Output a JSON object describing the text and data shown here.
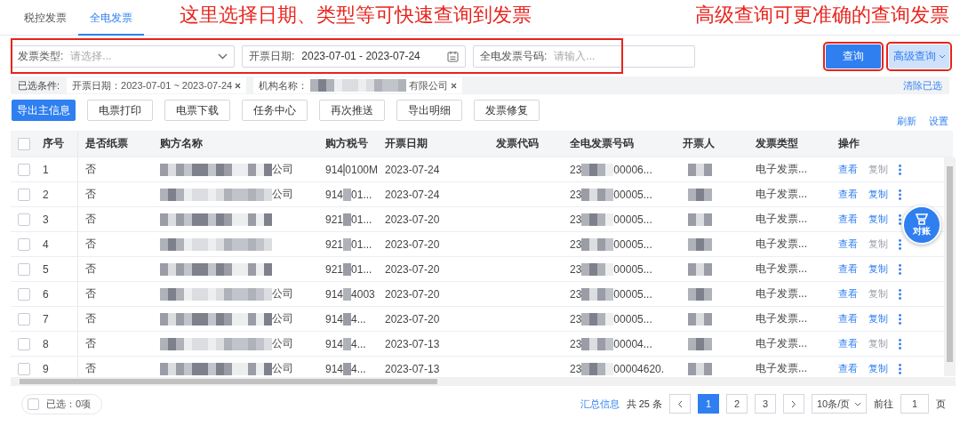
{
  "tabs": [
    {
      "label": "税控发票",
      "selected": false
    },
    {
      "label": "全电发票",
      "selected": true
    }
  ],
  "annotations": [
    "这里选择日期、类型等可快速查询到发票",
    "高级查询可更准确的查询发票"
  ],
  "filters": [
    {
      "kind": "select",
      "label": "发票类型:",
      "placeholder": "请选择..."
    },
    {
      "kind": "date",
      "label": "开票日期:",
      "value": "2023-07-01 - 2023-07-24"
    },
    {
      "kind": "input",
      "label": "全电发票号码:",
      "placeholder": "请输入..."
    }
  ],
  "search_button": "查询",
  "advanced_button": "高级查询",
  "conditions": {
    "label": "已选条件:",
    "chips": [
      {
        "text": "开票日期：2023-07-01 ~ 2023-07-24",
        "redacted": false
      },
      {
        "text": "机构名称：",
        "suffix": "有限公司",
        "redacted": true
      }
    ],
    "clear": "清除已选"
  },
  "toolbar": [
    {
      "label": "导出主信息",
      "kind": "primary"
    },
    {
      "label": "电票打印",
      "kind": "default"
    },
    {
      "label": "电票下载",
      "kind": "default"
    },
    {
      "label": "任务中心",
      "kind": "default"
    },
    {
      "label": "再次推送",
      "kind": "default"
    },
    {
      "label": "导出明细",
      "kind": "default"
    },
    {
      "label": "发票修复",
      "kind": "default"
    }
  ],
  "toolbar_links": [
    "刷新",
    "设置"
  ],
  "table": {
    "all_checked": false,
    "columns": [
      "序号",
      "是否纸票",
      "购方名称",
      "购方税号",
      "开票日期",
      "发票代码",
      "全电发票号码",
      "开票人",
      "发票类型",
      "操作"
    ],
    "rows": [
      {
        "seq": "1",
        "paper": "否",
        "name_suffix": "公司",
        "tax_head": "914",
        "tax_tail": "0100M",
        "date": "2023-07-24",
        "number_head": "23",
        "number_tail": "00006...",
        "type": "电子发票...",
        "view": "查看",
        "copy": "复制",
        "copy_enabled": false,
        "checked": false
      },
      {
        "seq": "2",
        "paper": "否",
        "name_suffix": "公司",
        "tax_head": "914",
        "tax_tail": "01...",
        "date": "2023-07-24",
        "number_head": "23",
        "number_tail": "00005...",
        "type": "电子发票...",
        "view": "查看",
        "copy": "复制",
        "copy_enabled": true,
        "checked": false
      },
      {
        "seq": "3",
        "paper": "否",
        "tax_head": "921",
        "tax_tail": "01...",
        "date": "2023-07-20",
        "number_head": "23",
        "number_tail": "00005...",
        "type": "电子发票...",
        "view": "查看",
        "copy": "复制",
        "copy_enabled": true,
        "checked": false
      },
      {
        "seq": "4",
        "paper": "否",
        "tax_head": "921",
        "tax_tail": "01...",
        "date": "2023-07-20",
        "number_head": "23",
        "number_tail": "00005...",
        "type": "电子发票...",
        "view": "查看",
        "copy": "复制",
        "copy_enabled": false,
        "checked": false
      },
      {
        "seq": "5",
        "paper": "否",
        "tax_head": "921",
        "tax_tail": "01...",
        "date": "2023-07-20",
        "number_head": "23",
        "number_tail": "00005...",
        "type": "电子发票...",
        "view": "查看",
        "copy": "复制",
        "copy_enabled": true,
        "checked": false
      },
      {
        "seq": "6",
        "paper": "否",
        "name_suffix": "公司",
        "tax_head": "914",
        "tax_tail": "4003",
        "date": "2023-07-20",
        "number_head": "23",
        "number_tail": "00005...",
        "type": "电子发票...",
        "view": "查看",
        "copy": "复制",
        "copy_enabled": false,
        "checked": false
      },
      {
        "seq": "7",
        "paper": "否",
        "name_suffix": "公司",
        "tax_head": "914",
        "tax_tail": "4...",
        "date": "2023-07-20",
        "number_head": "23",
        "number_tail": "00005...",
        "type": "电子发票...",
        "view": "查看",
        "copy": "复制",
        "copy_enabled": true,
        "checked": false
      },
      {
        "seq": "8",
        "paper": "否",
        "name_suffix": "公司",
        "tax_head": "914",
        "tax_tail": "4...",
        "date": "2023-07-13",
        "number_head": "23",
        "number_tail": "00004...",
        "type": "电子发票...",
        "view": "查看",
        "copy": "复制",
        "copy_enabled": false,
        "checked": false
      },
      {
        "seq": "9",
        "paper": "否",
        "name_suffix": "公司",
        "tax_head": "914",
        "tax_tail": "4...",
        "date": "2023-07-13",
        "number_head": "23",
        "number_tail": "00004620.",
        "type": "电子发票...",
        "view": "查看",
        "copy": "复制",
        "copy_enabled": true,
        "checked": false
      }
    ]
  },
  "float_button": "对账",
  "footer": {
    "select_all_checked": false,
    "selected": "已选：0项",
    "summary": "汇总信息",
    "total": "共 25 条",
    "pages": [
      {
        "label": "1",
        "selected": true
      },
      {
        "label": "2",
        "selected": false
      },
      {
        "label": "3",
        "selected": false
      }
    ],
    "page_size": "10条/页",
    "goto": "前往",
    "goto_value": "1",
    "page_unit": "页"
  }
}
